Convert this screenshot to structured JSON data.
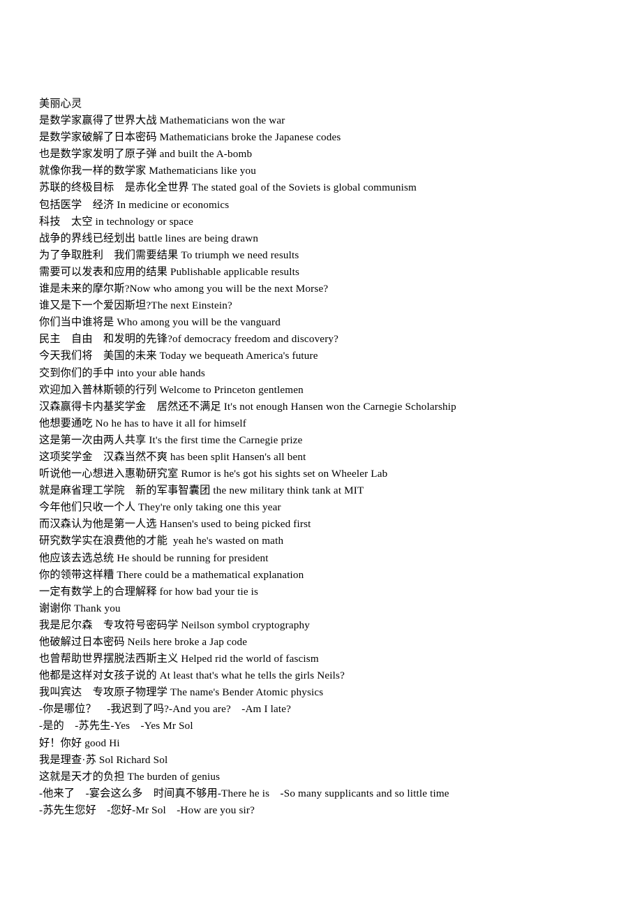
{
  "document": {
    "title": "美丽心灵",
    "type": "bilingual-subtitle-transcript",
    "background_color": "#ffffff",
    "text_color": "#000000",
    "lines": [
      "美丽心灵",
      "是数学家赢得了世界大战 Mathematicians won the war",
      "是数学家破解了日本密码 Mathematicians broke the Japanese codes",
      "也是数学家发明了原子弹 and built the A-bomb",
      "就像你我一样的数学家 Mathematicians like you",
      "苏联的终极目标　是赤化全世界 The stated goal of the Soviets is global communism",
      "包括医学　经济 In medicine or economics",
      "科技　太空 in technology or space",
      "战争的界线已经划出 battle lines are being drawn",
      "为了争取胜利　我们需要结果 To triumph we need results",
      "需要可以发表和应用的结果 Publishable applicable results",
      "谁是未来的摩尔斯?Now who among you will be the next Morse?",
      "谁又是下一个爱因斯坦?The next Einstein?",
      "你们当中谁将是 Who among you will be the vanguard",
      "民主　自由　和发明的先锋?of democracy freedom and discovery?",
      "今天我们将　美国的未来 Today we bequeath America's future",
      "交到你们的手中 into your able hands",
      "欢迎加入普林斯顿的行列 Welcome to Princeton gentlemen",
      "汉森赢得卡内基奖学金　居然还不满足 It's not enough Hansen won the Carnegie Scholarship",
      "他想要通吃 No he has to have it all for himself",
      "这是第一次由两人共享 It's the first time the Carnegie prize",
      "这项奖学金　汉森当然不爽 has been split Hansen's all bent",
      "听说他一心想进入惠勒研究室 Rumor is he's got his sights set on Wheeler Lab",
      "就是麻省理工学院　新的军事智囊团 the new military think tank at MIT",
      "今年他们只收一个人 They're only taking one this year",
      "而汉森认为他是第一人选 Hansen's used to being picked first",
      "研究数学实在浪费他的才能  yeah he's wasted on math",
      "他应该去选总统 He should be running for president",
      "你的领带这样糟 There could be a mathematical explanation",
      "一定有数学上的合理解释 for how bad your tie is",
      "谢谢你 Thank you",
      "我是尼尔森　专攻符号密码学 Neilson symbol cryptography",
      "他破解过日本密码 Neils here broke a Jap code",
      "也曾帮助世界摆脱法西斯主义 Helped rid the world of fascism",
      "他都是这样对女孩子说的 At least that's what he tells the girls Neils?",
      "我叫宾达　专攻原子物理学 The name's Bender Atomic physics",
      "-你是哪位？　-我迟到了吗?-And you are?　-Am I late?",
      "-是的　-苏先生-Yes　-Yes Mr Sol",
      "好！你好 good Hi",
      "我是理查·苏 Sol Richard Sol",
      "这就是天才的负担 The burden of genius",
      "-他来了　-宴会这么多　时间真不够用-There he is　-So many supplicants and so little time",
      "-苏先生您好　-您好-Mr Sol　-How are you sir?"
    ]
  }
}
